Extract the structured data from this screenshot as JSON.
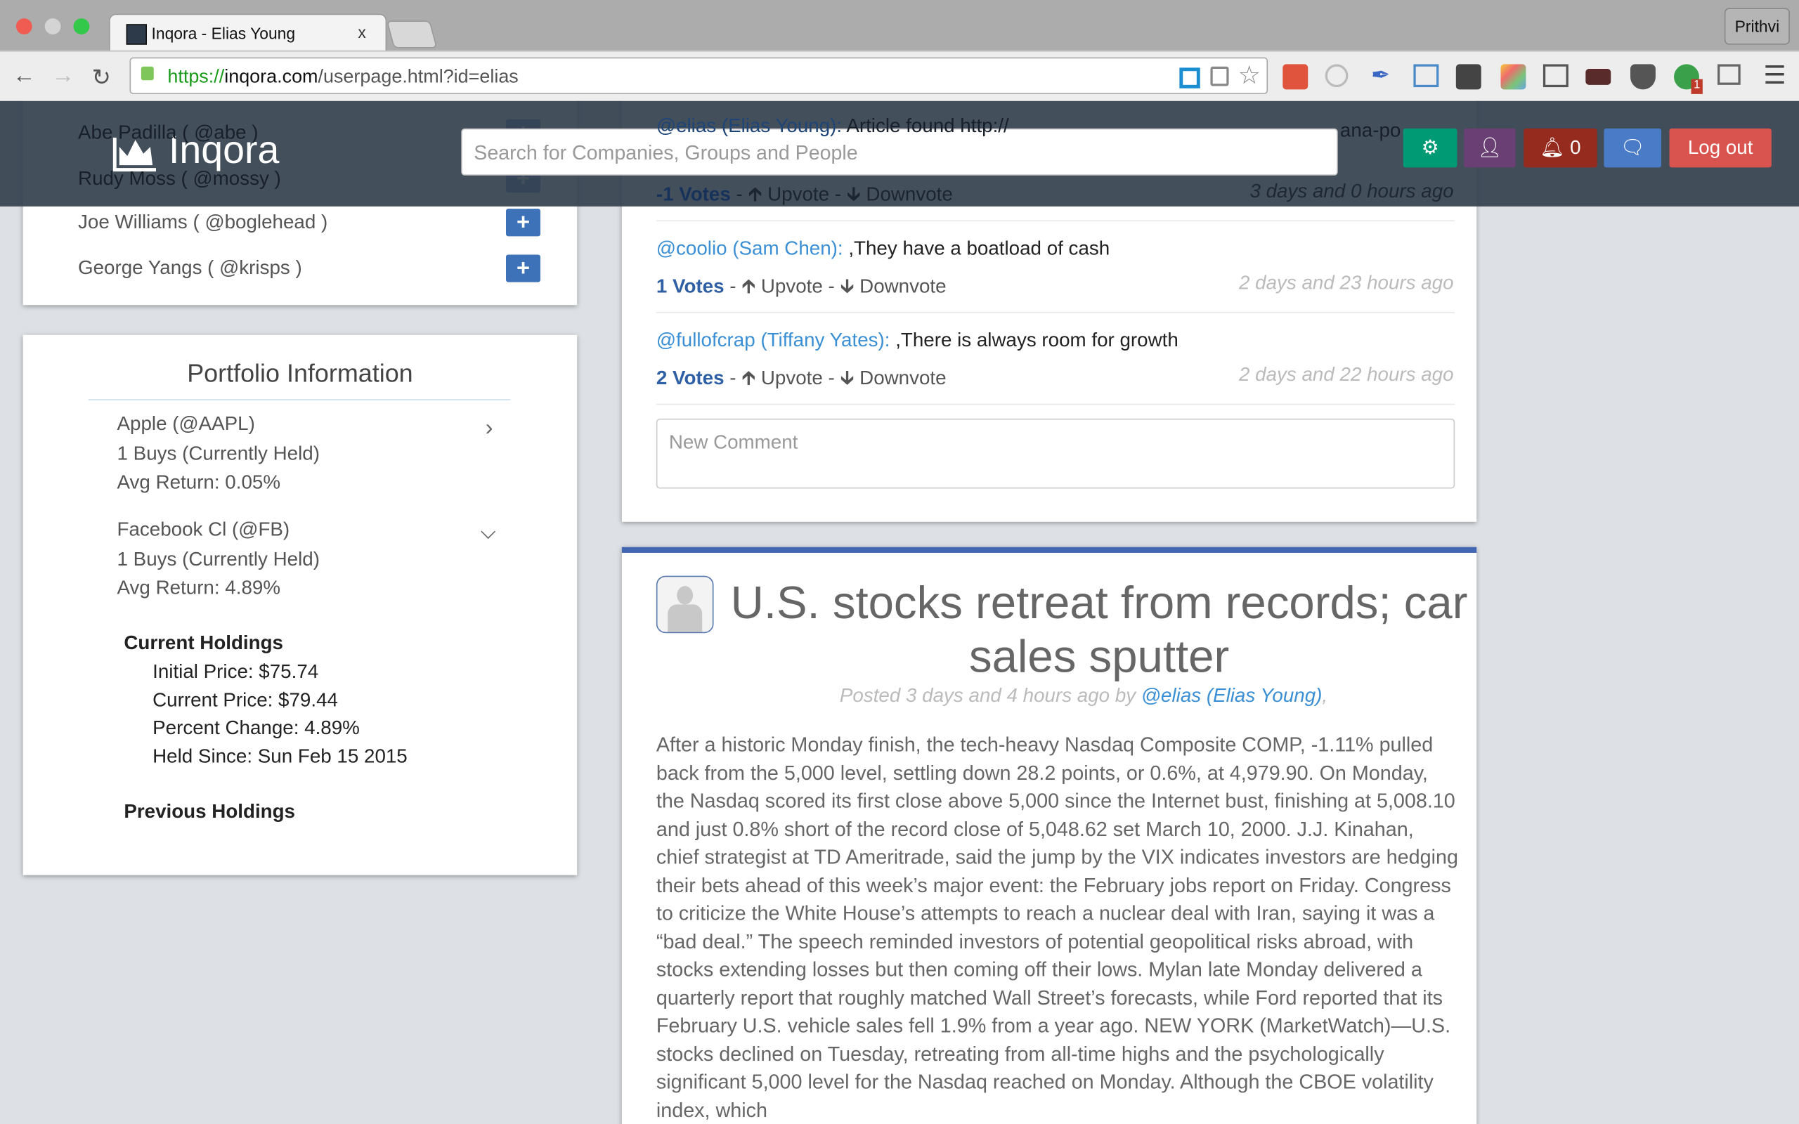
{
  "browser": {
    "tab_title": "Inqora - Elias Young",
    "tab_close": "x",
    "profile": "Prithvi",
    "url_proto": "https://",
    "url_host": "inqora.com",
    "url_path": "/userpage.html?id=elias"
  },
  "navbar": {
    "brand": "Inqora",
    "search_placeholder": "Search for Companies, Groups and People",
    "notification_count": "0",
    "logout": "Log out",
    "colors": {
      "settings": "#009a74",
      "profile": "#6a3f74",
      "notifications": "#952a1e",
      "messages": "#4a7bc6",
      "logout": "#d9534f"
    }
  },
  "following": [
    {
      "label": "Abe Padilla ( @abe )"
    },
    {
      "label": "Rudy Moss ( @mossy )"
    },
    {
      "label": "Joe Williams ( @boglehead )"
    },
    {
      "label": "George Yangs ( @krisps )"
    }
  ],
  "portfolio": {
    "title": "Portfolio Information",
    "items": [
      {
        "name": "Apple (@AAPL)",
        "buys": "1 Buys (Currently Held)",
        "avg": "Avg Return: 0.05%",
        "expanded": false
      },
      {
        "name": "Facebook Cl (@FB)",
        "buys": "1 Buys (Currently Held)",
        "avg": "Avg Return: 4.89%",
        "expanded": true
      }
    ],
    "current_heading": "Current Holdings",
    "current": [
      "Initial Price: $75.74",
      "Current Price: $79.44",
      "Percent Change: 4.89%",
      "Held Since: Sun Feb 15 2015"
    ],
    "previous_heading": "Previous Holdings"
  },
  "comments": [
    {
      "who": "@elias (Elias Young):",
      "text": " Article found http://",
      "tail": "ana-po",
      "votes": "-1 Votes",
      "ago": "3 days and 0 hours ago"
    },
    {
      "who": "@coolio (Sam Chen):",
      "text": " ,They have a boatload of cash",
      "votes": "1 Votes",
      "ago": "2 days and 23 hours ago"
    },
    {
      "who": "@fullofcrap (Tiffany Yates):",
      "text": " ,There is always room for growth",
      "votes": "2 Votes",
      "ago": "2 days and 22 hours ago"
    }
  ],
  "vote_labels": {
    "sep": " - ",
    "up": "Upvote",
    "down": "Downvote"
  },
  "new_comment_placeholder": "New Comment",
  "article": {
    "title": "U.S. stocks retreat from records; car sales sputter",
    "posted": "Posted 3 days and 4 hours ago by ",
    "author": "@elias (Elias Young)",
    "posted_tail": ",",
    "body": "After a historic Monday finish, the tech-heavy Nasdaq Composite COMP, -1.11% pulled back from the 5,000 level, settling down 28.2 points, or 0.6%, at 4,979.90. On Monday, the Nasdaq scored its first close above 5,000 since the Internet bust, finishing at 5,008.10 and just 0.8% short of the record close of 5,048.62 set March 10, 2000. J.J. Kinahan, chief strategist at TD Ameritrade, said the jump by the VIX indicates investors are hedging their bets ahead of this week’s major event: the February jobs report on Friday. Congress to criticize the White House’s attempts to reach a nuclear deal with Iran, saying it was a “bad deal.” The speech reminded investors of potential geopolitical risks abroad, with stocks extending losses but then coming off their lows. Mylan late Monday delivered a quarterly report that roughly matched Wall Street’s forecasts, while Ford reported that its February U.S. vehicle sales fell 1.9% from a year ago. NEW YORK (MarketWatch)—U.S. stocks declined on Tuesday, retreating from all-time highs and the psychologically significant 5,000 level for the Nasdaq reached on Monday. Although the CBOE volatility index, which"
  }
}
